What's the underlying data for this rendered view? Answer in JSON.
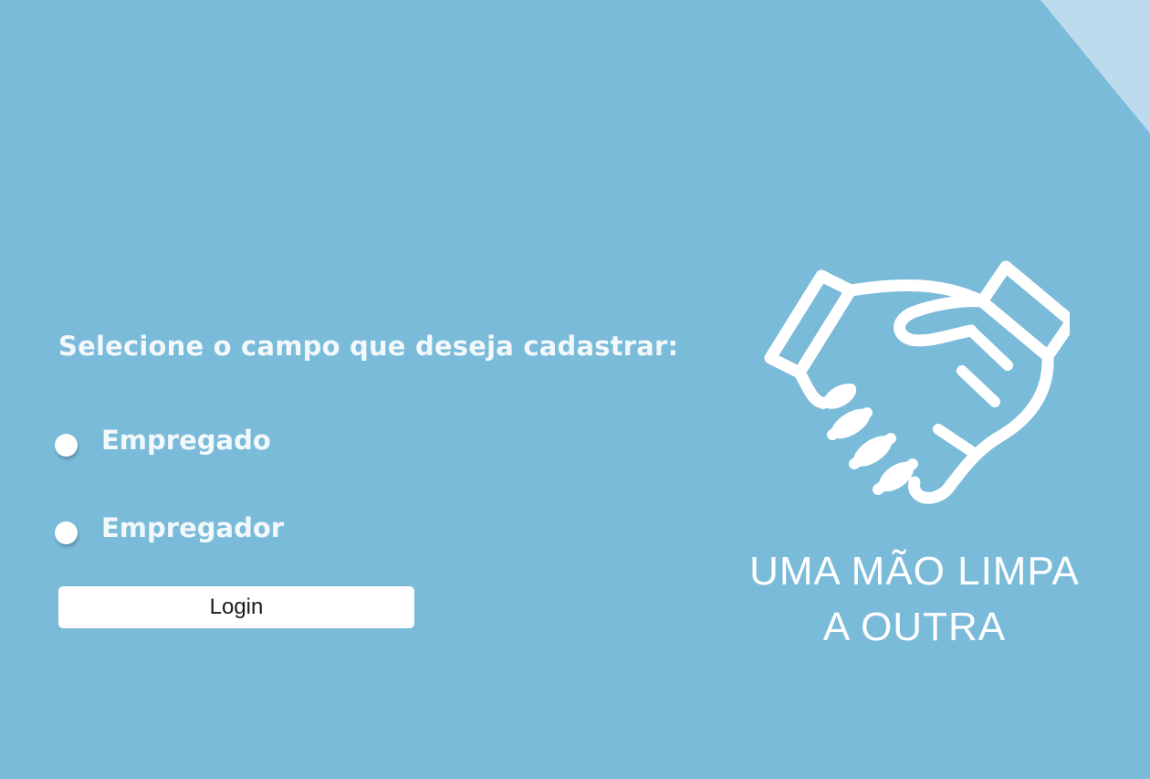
{
  "page": {
    "background_color": "#7abbd9",
    "corner_accent_color": "#bcdced"
  },
  "form": {
    "prompt": "Selecione o campo que deseja cadastrar:",
    "options": [
      {
        "label": "Empregado",
        "selected": false
      },
      {
        "label": "Empregador",
        "selected": false
      }
    ],
    "login_label": "Login"
  },
  "logo": {
    "icon": "handshake-icon",
    "line1": "UMA MÃO LIMPA",
    "line2": "A OUTRA"
  }
}
